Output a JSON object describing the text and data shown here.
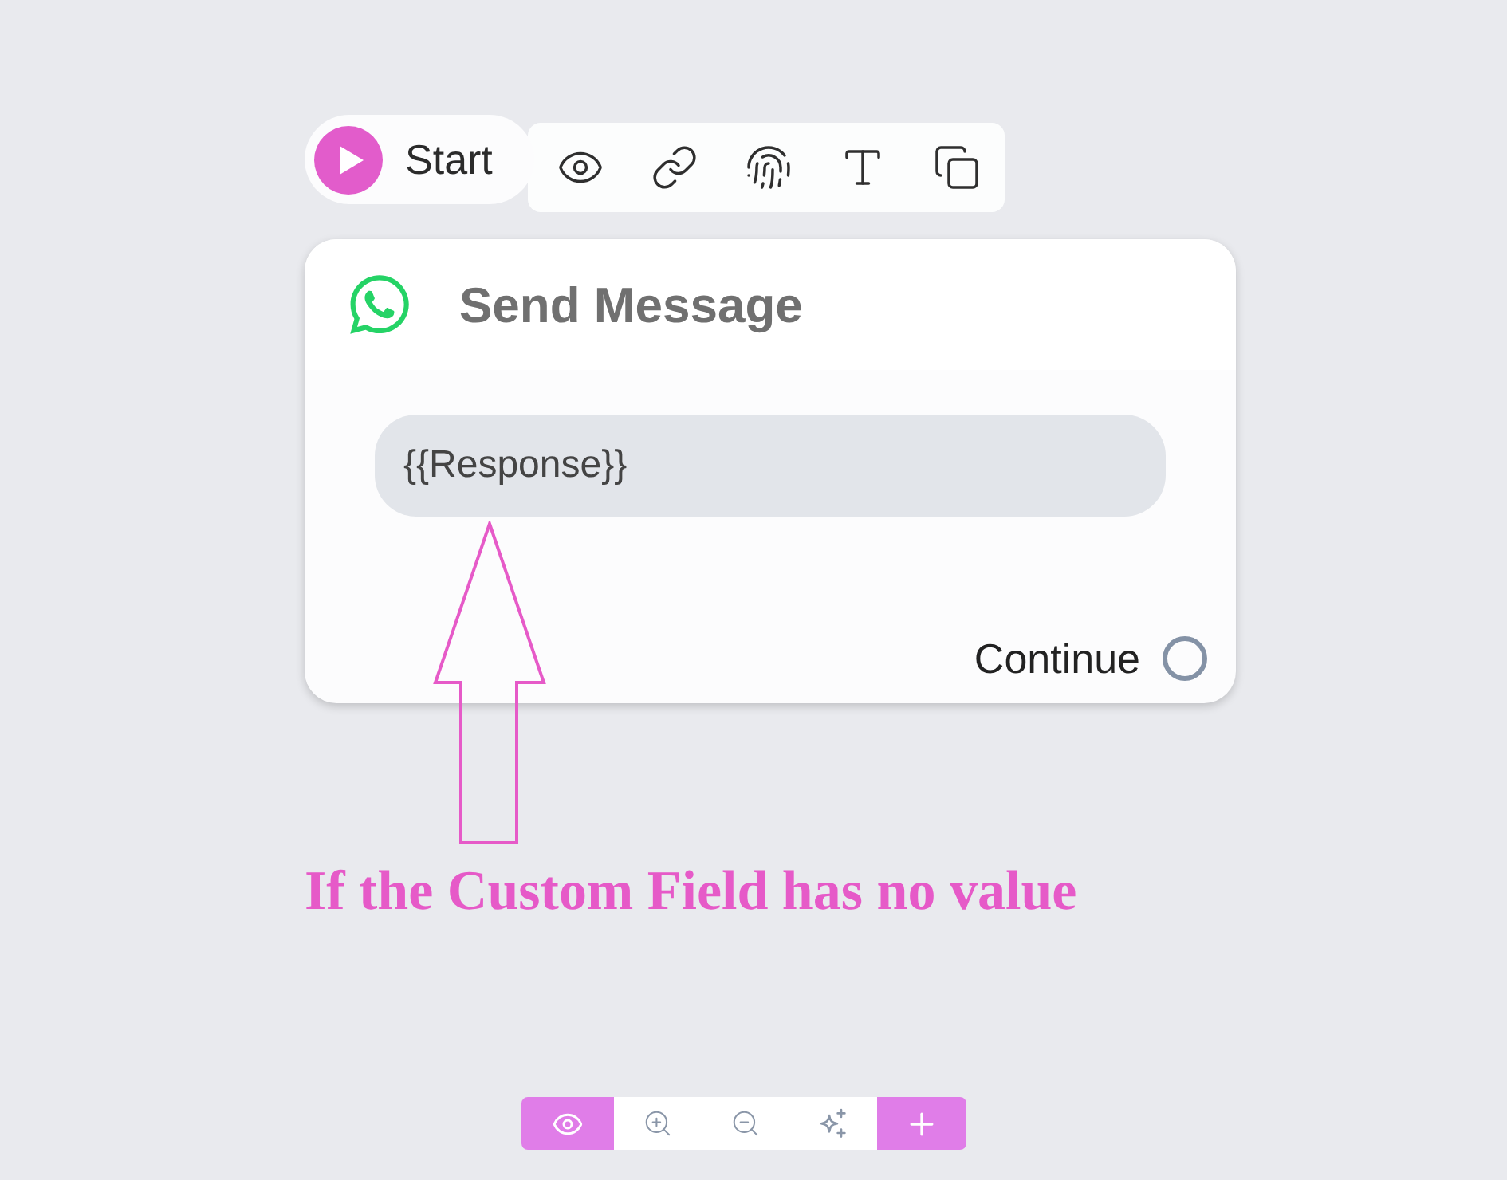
{
  "start_node": {
    "label": "Start"
  },
  "node": {
    "title": "Send Message",
    "message_field": {
      "value": "{{Response}}"
    },
    "output": {
      "label": "Continue"
    }
  },
  "annotation": {
    "text": "If the Custom Field has no value"
  }
}
